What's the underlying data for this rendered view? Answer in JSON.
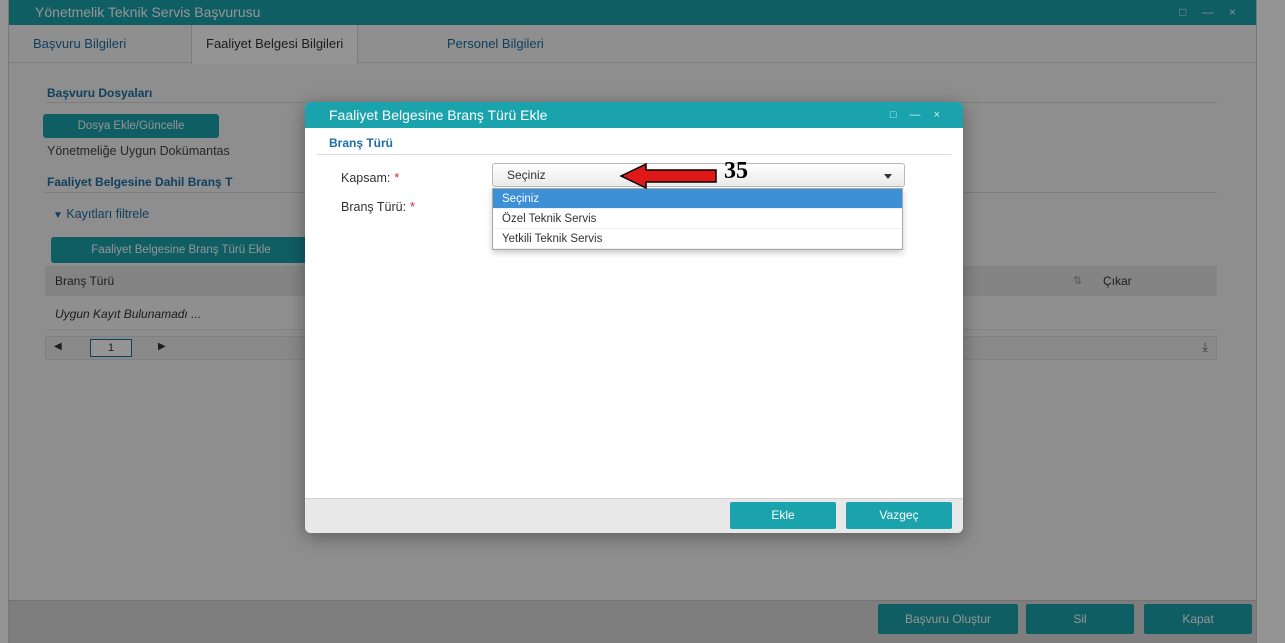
{
  "window": {
    "title": "Yönetmelik Teknik Servis Başvurusu",
    "controls": "□ — ×"
  },
  "tabs": [
    {
      "label": "Başvuru Bilgileri"
    },
    {
      "label": "Faaliyet Belgesi Bilgileri"
    },
    {
      "label": "Personel Bilgileri"
    }
  ],
  "background": {
    "section1_title": "Başvuru Dosyaları",
    "upload_button": "Dosya Ekle/Güncelle",
    "doc_text": "Yönetmeliğe Uygun Dokümantas",
    "section2_title": "Faaliyet Belgesine Dahil Branş T",
    "filter_toggle": "Kayıtları filtrele",
    "add_branch_button": "Faaliyet Belgesine Branş Türü Ekle",
    "grid_col_branch": "Branş Türü",
    "grid_col_remove": "Çıkar",
    "empty_message": "Uygun Kayıt Bulunamadı ...",
    "page_number": "1"
  },
  "footer": {
    "create_button": "Başvuru Oluştur",
    "delete_button": "Sil",
    "close_button": "Kapat"
  },
  "modal": {
    "title": "Faaliyet Belgesine Branş Türü Ekle",
    "controls": "□ — ×",
    "section_title": "Branş Türü",
    "field_scope_label": "Kapsam:",
    "field_branch_label": "Branş Türü:",
    "required_mark": "*",
    "scope_selected": "Seçiniz",
    "scope_options": [
      "Seçiniz",
      "Özel Teknik Servis",
      "Yetkili Teknik Servis"
    ],
    "add_button": "Ekle",
    "cancel_button": "Vazgeç"
  },
  "annotation": {
    "number": "35",
    "arrow_color": "#e01818"
  }
}
